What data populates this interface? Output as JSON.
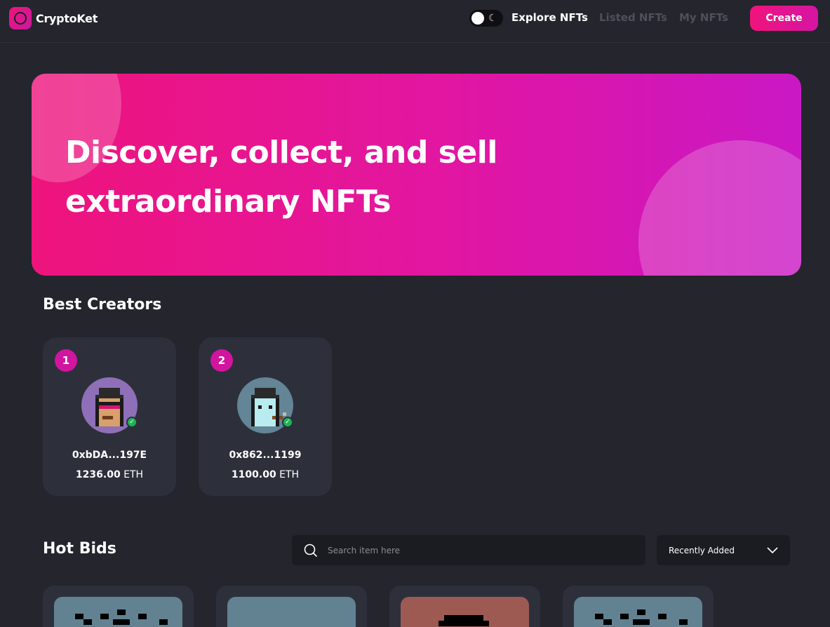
{
  "nav": {
    "logo_text": "CryptoKet",
    "links": [
      "Explore NFTs",
      "Listed NFTs",
      "My NFTs"
    ],
    "create_label": "Create"
  },
  "hero": {
    "title": "Discover, collect, and sell extraordinary NFTs"
  },
  "creators": {
    "title": "Best Creators",
    "items": [
      {
        "rank": "1",
        "address": "0xbDA...197E",
        "amount": "1236.00",
        "currency": "ETH"
      },
      {
        "rank": "2",
        "address": "0x862...1199",
        "amount": "1100.00",
        "currency": "ETH"
      }
    ]
  },
  "bids": {
    "title": "Hot Bids",
    "search_placeholder": "Search item here",
    "sort_label": "Recently Added"
  },
  "colors": {
    "accent": "#e8157f",
    "background": "#24252d",
    "card": "#2d303b"
  }
}
